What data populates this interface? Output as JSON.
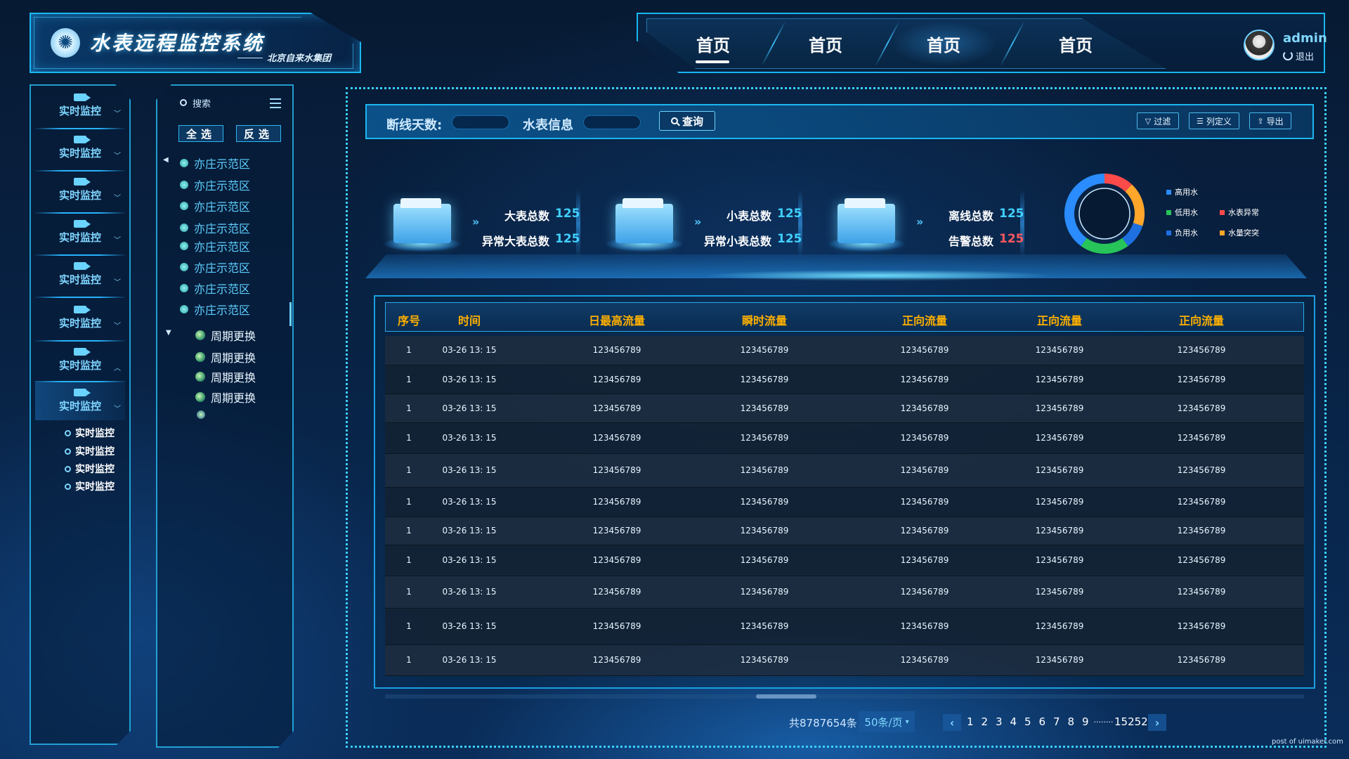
{
  "header": {
    "title": "水表远程监控系统",
    "subtitle": "北京自来水集团",
    "tabs": [
      "首页",
      "首页",
      "首页",
      "首页"
    ],
    "active_tab": 0,
    "user": {
      "name": "admin",
      "logout": "退出"
    }
  },
  "sidebar": {
    "items": [
      "实时监控",
      "实时监控",
      "实时监控",
      "实时监控",
      "实时监控",
      "实时监控",
      "实时监控",
      "实时监控"
    ],
    "sub_items": [
      "实时监控",
      "实时监控",
      "实时监控",
      "实时监控"
    ],
    "open_index": 7
  },
  "tree": {
    "search_placeholder": "搜索",
    "select_all": "全选",
    "invert": "反选",
    "nodes": [
      "亦庄示范区",
      "亦庄示范区",
      "亦庄示范区",
      "亦庄示范区",
      "亦庄示范区",
      "亦庄示范区",
      "亦庄示范区",
      "亦庄示范区"
    ],
    "children": [
      "周期更换",
      "周期更换",
      "周期更换",
      "周期更换"
    ]
  },
  "filter": {
    "offline_days_label": "断线天数:",
    "meter_info_label": "水表信息",
    "query": "查询",
    "filter_btn": "过滤",
    "columns_btn": "列定义",
    "export_btn": "导出"
  },
  "stats": [
    {
      "label1": "大表总数",
      "value1": "125",
      "label2": "异常大表总数",
      "value2": "125"
    },
    {
      "label1": "小表总数",
      "value1": "125",
      "label2": "异常小表总数",
      "value2": "125"
    },
    {
      "label1": "离线总数",
      "value1": "125",
      "label2": "告警总数",
      "value2": "125"
    }
  ],
  "donut": {
    "segments": [
      {
        "name": "高用水",
        "color": "#2a8cff",
        "value": 40
      },
      {
        "name": "低用水",
        "color": "#27c45a",
        "value": 20
      },
      {
        "name": "负用水",
        "color": "#1e6fe0",
        "value": 10
      },
      {
        "name": "水表异常",
        "color": "#ff4a4a",
        "value": 12
      },
      {
        "name": "水量突突",
        "color": "#ffa62b",
        "value": 18
      }
    ]
  },
  "table": {
    "columns": [
      "序号",
      "时间",
      "日最高流量",
      "瞬时流量",
      "正向流量",
      "正向流量",
      "正向流量"
    ],
    "rows": [
      [
        "1",
        "03-26 13: 15",
        "123456789",
        "123456789",
        "123456789",
        "123456789",
        "123456789"
      ],
      [
        "1",
        "03-26 13: 15",
        "123456789",
        "123456789",
        "123456789",
        "123456789",
        "123456789"
      ],
      [
        "1",
        "03-26 13: 15",
        "123456789",
        "123456789",
        "123456789",
        "123456789",
        "123456789"
      ],
      [
        "1",
        "03-26 13: 15",
        "123456789",
        "123456789",
        "123456789",
        "123456789",
        "123456789"
      ],
      [
        "1",
        "03-26 13: 15",
        "123456789",
        "123456789",
        "123456789",
        "123456789",
        "123456789"
      ],
      [
        "1",
        "03-26 13: 15",
        "123456789",
        "123456789",
        "123456789",
        "123456789",
        "123456789"
      ],
      [
        "1",
        "03-26 13: 15",
        "123456789",
        "123456789",
        "123456789",
        "123456789",
        "123456789"
      ],
      [
        "1",
        "03-26 13: 15",
        "123456789",
        "123456789",
        "123456789",
        "123456789",
        "123456789"
      ],
      [
        "1",
        "03-26 13: 15",
        "123456789",
        "123456789",
        "123456789",
        "123456789",
        "123456789"
      ],
      [
        "1",
        "03-26 13: 15",
        "123456789",
        "123456789",
        "123456789",
        "123456789",
        "123456789"
      ],
      [
        "1",
        "03-26 13: 15",
        "123456789",
        "123456789",
        "123456789",
        "123456789",
        "123456789"
      ]
    ]
  },
  "pagination": {
    "total": "共8787654条",
    "page_size": "50条/页",
    "pages": [
      "1",
      "2",
      "3",
      "4",
      "5",
      "6",
      "7",
      "8",
      "9"
    ],
    "ellipsis": "........",
    "last": "15252"
  },
  "watermark": "post of uimaker.com"
}
